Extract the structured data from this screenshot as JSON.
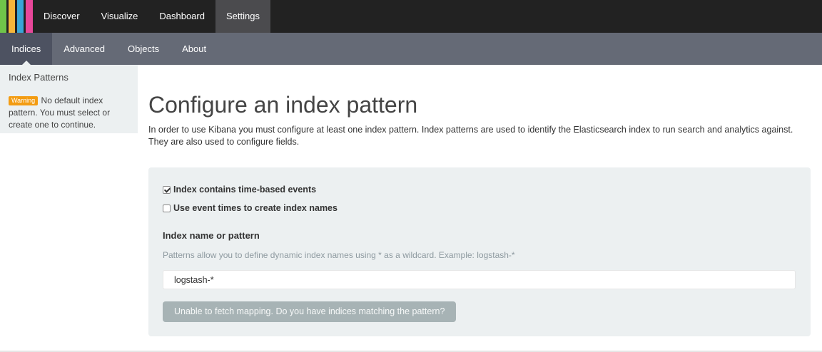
{
  "colors": {
    "logo_stripes": [
      "#70c44a",
      "#f6b63a",
      "#39a6d8",
      "#e8479a"
    ],
    "topnav_bg": "#222222",
    "subnav_bg": "#656a76",
    "warning_badge": "#f39c12"
  },
  "topnav": {
    "tabs": [
      {
        "label": "Discover"
      },
      {
        "label": "Visualize"
      },
      {
        "label": "Dashboard"
      },
      {
        "label": "Settings",
        "active": true
      }
    ]
  },
  "subnav": {
    "tabs": [
      {
        "label": "Indices",
        "active": true
      },
      {
        "label": "Advanced"
      },
      {
        "label": "Objects"
      },
      {
        "label": "About"
      }
    ]
  },
  "sidebar": {
    "title": "Index Patterns",
    "warning_badge": "Warning",
    "warning_text": "No default index pattern. You must select or create one to continue."
  },
  "main": {
    "title": "Configure an index pattern",
    "description": "In order to use Kibana you must configure at least one index pattern. Index patterns are used to identify the Elasticsearch index to run search and analytics against. They are also used to configure fields."
  },
  "form": {
    "time_based_label": "Index contains time-based events",
    "time_based_checked": true,
    "event_times_label": "Use event times to create index names",
    "event_times_checked": false,
    "index_label": "Index name or pattern",
    "index_help": "Patterns allow you to define dynamic index names using * as a wildcard. Example: logstash-*",
    "index_value": "logstash-*",
    "submit_label": "Unable to fetch mapping. Do you have indices matching the pattern?"
  }
}
